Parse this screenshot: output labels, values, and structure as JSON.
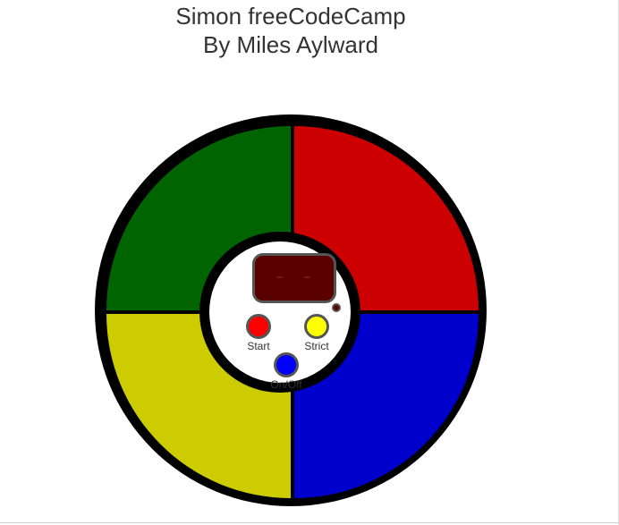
{
  "header": {
    "title_line1": "Simon freeCodeCamp",
    "title_line2": "By Miles Aylward"
  },
  "board": {
    "pads": [
      {
        "name": "green",
        "color": "#006400"
      },
      {
        "name": "red",
        "color": "#cc0000"
      },
      {
        "name": "yellow",
        "color": "#cccc00"
      },
      {
        "name": "blue",
        "color": "#0000cc"
      }
    ],
    "display": {
      "count_text": "- -"
    },
    "buttons": {
      "start": {
        "label": "Start",
        "color": "#ff0000"
      },
      "strict": {
        "label": "Strict",
        "color": "#ffff00"
      },
      "power": {
        "label": "On/Off",
        "color": "#0000ff"
      }
    }
  }
}
